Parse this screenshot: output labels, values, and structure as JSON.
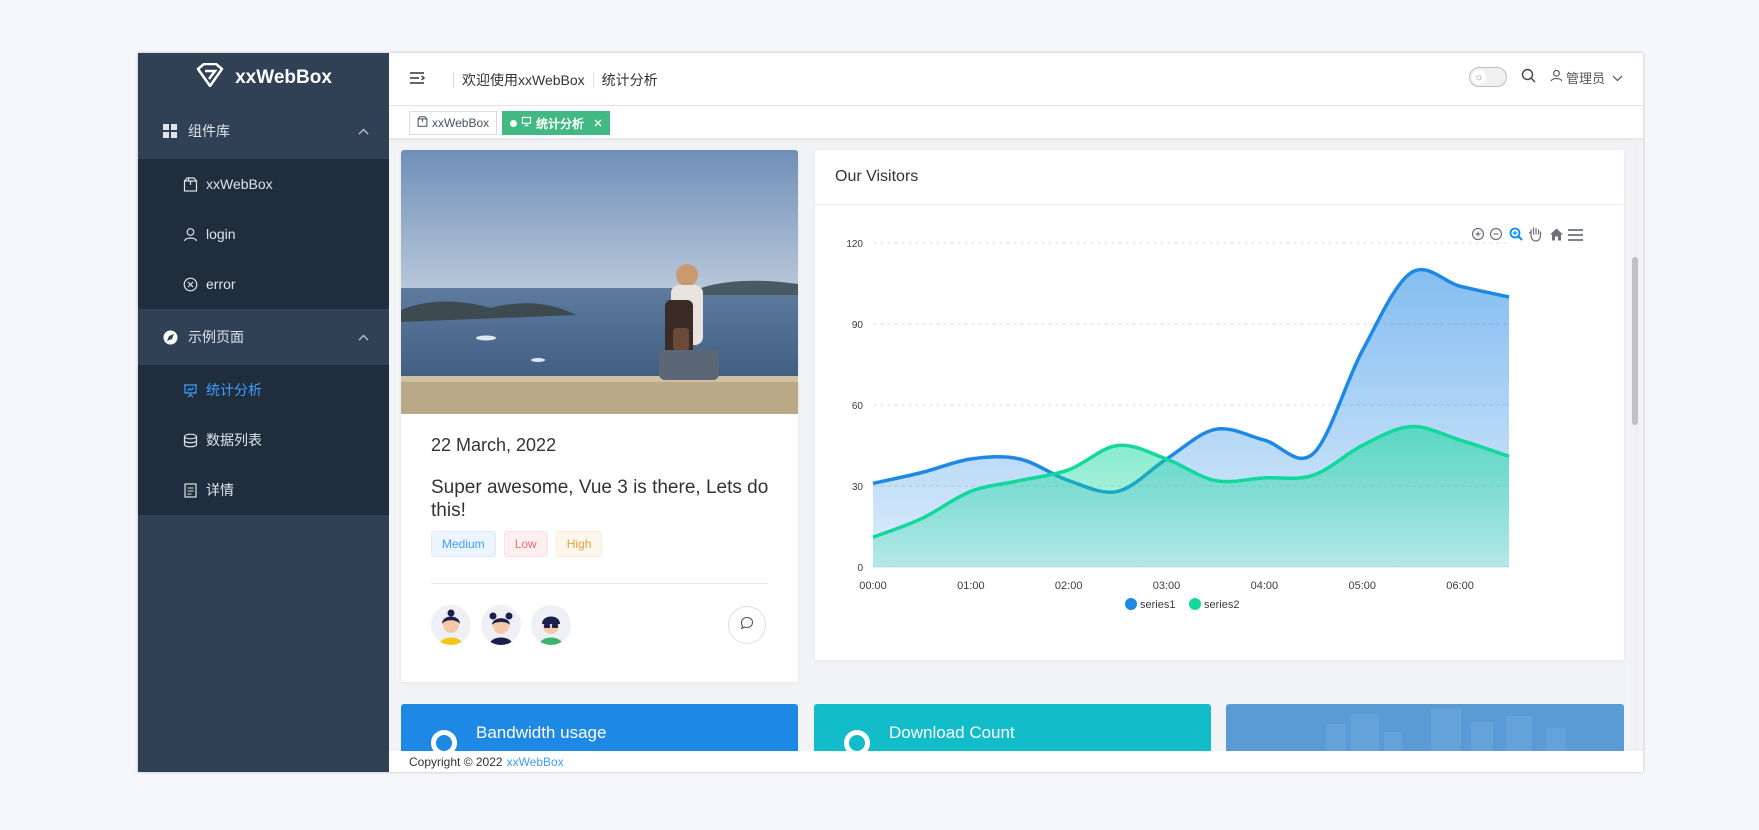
{
  "brand": {
    "name": "xxWebBox"
  },
  "sidebar": {
    "groups": [
      {
        "label": "组件库",
        "items": [
          {
            "label": "xxWebBox"
          },
          {
            "label": "login"
          },
          {
            "label": "error"
          }
        ]
      },
      {
        "label": "示例页面",
        "items": [
          {
            "label": "统计分析"
          },
          {
            "label": "数据列表"
          },
          {
            "label": "详情"
          }
        ]
      }
    ]
  },
  "header": {
    "crumbs": [
      "欢迎使用xxWebBox",
      "统计分析"
    ],
    "user": "管理员"
  },
  "tags": [
    {
      "label": "xxWebBox"
    },
    {
      "label": "统计分析"
    }
  ],
  "post": {
    "date": "22 March, 2022",
    "title": "Super awesome, Vue 3 is there, Lets do this!",
    "badges": [
      "Medium",
      "Low",
      "High"
    ]
  },
  "chart_card": {
    "title": "Our Visitors"
  },
  "chart_data": {
    "type": "area",
    "x": [
      "00:00",
      "01:00",
      "02:00",
      "03:00",
      "04:00",
      "05:00",
      "06:00"
    ],
    "series": [
      {
        "name": "series1",
        "color": "#1e88e5",
        "points": [
          [
            0,
            31
          ],
          [
            0.5,
            35
          ],
          [
            1,
            40
          ],
          [
            1.5,
            40
          ],
          [
            2,
            32
          ],
          [
            2.5,
            28
          ],
          [
            3,
            40
          ],
          [
            3.5,
            51
          ],
          [
            4,
            47
          ],
          [
            4.5,
            42
          ],
          [
            5,
            80
          ],
          [
            5.5,
            109
          ],
          [
            6,
            104
          ],
          [
            6.5,
            100
          ]
        ]
      },
      {
        "name": "series2",
        "color": "#13d89b",
        "points": [
          [
            0,
            11
          ],
          [
            0.5,
            18
          ],
          [
            1,
            28
          ],
          [
            1.5,
            32
          ],
          [
            2,
            36
          ],
          [
            2.5,
            45
          ],
          [
            3,
            40
          ],
          [
            3.5,
            32
          ],
          [
            4,
            33
          ],
          [
            4.5,
            34
          ],
          [
            5,
            45
          ],
          [
            5.5,
            52
          ],
          [
            6,
            47
          ],
          [
            6.5,
            41
          ]
        ]
      }
    ],
    "yticks": [
      0,
      30,
      60,
      90,
      120
    ],
    "ylim": [
      0,
      120
    ],
    "xlim": [
      0,
      6.5
    ],
    "legend": "bottom-center",
    "grid": true
  },
  "stats": [
    {
      "title": "Bandwidth usage"
    },
    {
      "title": "Download Count"
    }
  ],
  "footer": {
    "text": "Copyright © 2022",
    "link": "xxWebBox"
  }
}
